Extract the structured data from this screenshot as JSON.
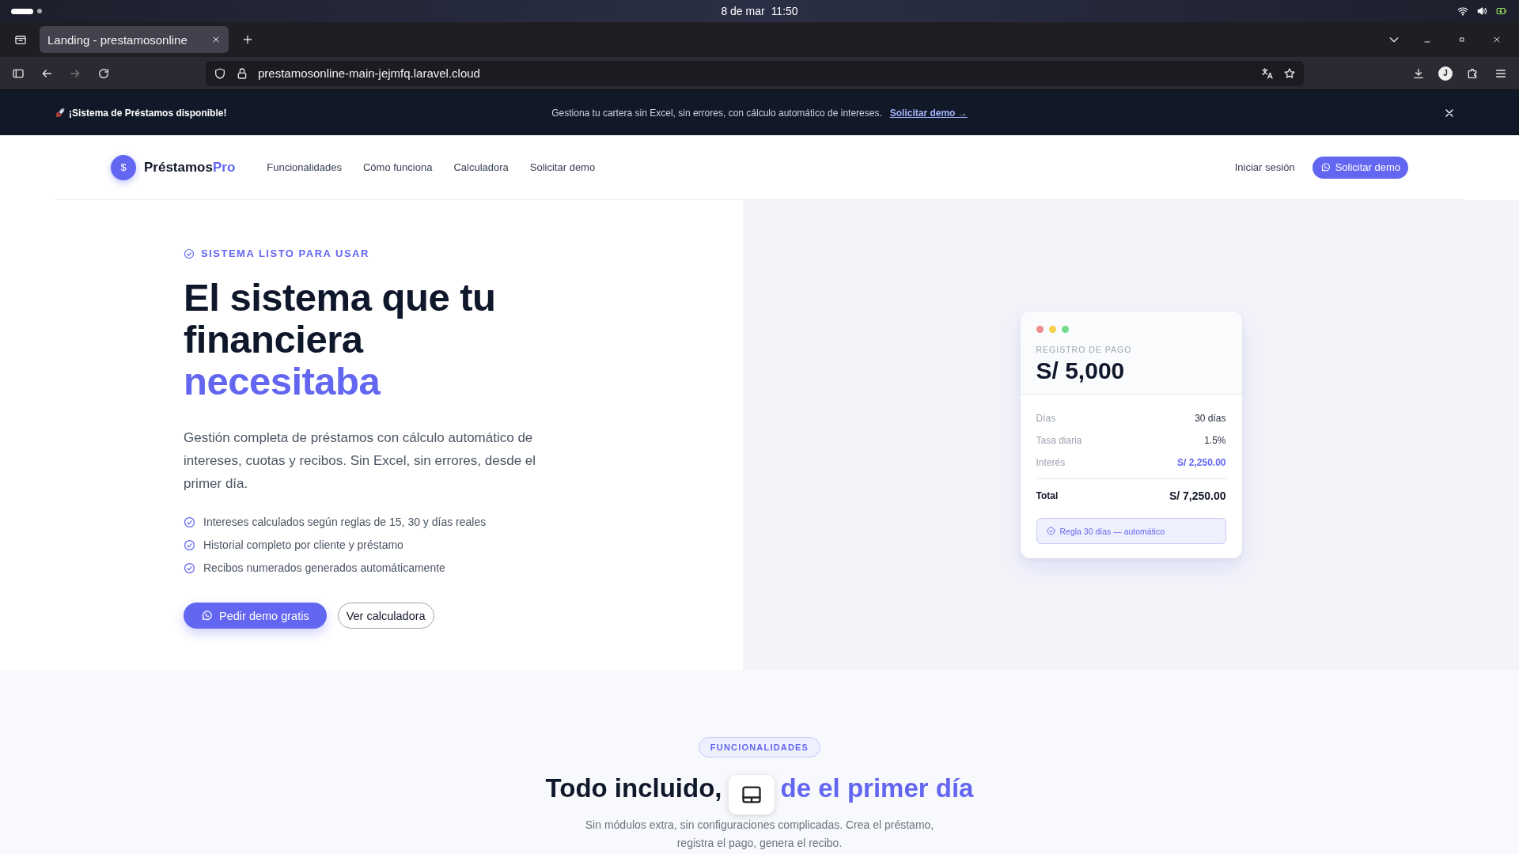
{
  "os_bar": {
    "date": "8 de mar",
    "time": "11:50"
  },
  "browser": {
    "tabs": [
      {
        "title": "Landing - prestamosonline",
        "selected": true
      }
    ],
    "url": "prestamosonline-main-jejmfq.laravel.cloud",
    "profile_initial": "J"
  },
  "announcement": {
    "title": "¡Sistema de Préstamos disponible!",
    "message": "Gestiona tu cartera sin Excel, sin errores, con cálculo automático de intereses.",
    "link": "Solicitar demo →"
  },
  "nav": {
    "logo_mark": "$",
    "brand": "Préstamos",
    "brand_accent": "Pro",
    "links": [
      "Funcionalidades",
      "Cómo funciona",
      "Calculadora",
      "Solicitar demo"
    ],
    "login": "Iniciar sesión",
    "cta": "Solicitar demo"
  },
  "hero": {
    "eyebrow": "SISTEMA LISTO PARA USAR",
    "title_lines": [
      "El sistema que tu",
      "financiera"
    ],
    "title_accent": "necesitaba",
    "description": "Gestión completa de préstamos con cálculo automático de intereses, cuotas y recibos. Sin Excel, sin errores, desde el primer día.",
    "features": [
      "Intereses calculados según reglas de 15, 30 y días reales",
      "Historial completo por cliente y préstamo",
      "Recibos numerados generados automáticamente"
    ],
    "primary_button": "Pedir demo gratis",
    "secondary_button": "Ver calculadora"
  },
  "payment_card": {
    "label": "REGISTRO DE PAGO",
    "amount": "S/ 5,000",
    "rows": [
      {
        "label": "Días",
        "value": "30 días",
        "kind": "plain"
      },
      {
        "label": "Tasa diaria",
        "value": "1.5%",
        "kind": "plain"
      },
      {
        "label": "Interés",
        "value": "S/ 2,250.00",
        "kind": "accent"
      }
    ],
    "total_label": "Total",
    "total_value": "S/ 7,250.00",
    "rule": "Regla 30 días — automático"
  },
  "features_section": {
    "badge": "FUNCIONALIDADES",
    "title": "Todo incluido,",
    "title_accent": "de el primer día",
    "subtitle": "Sin módulos extra, sin configuraciones complicadas. Crea el préstamo, registra el pago, genera el recibo."
  }
}
